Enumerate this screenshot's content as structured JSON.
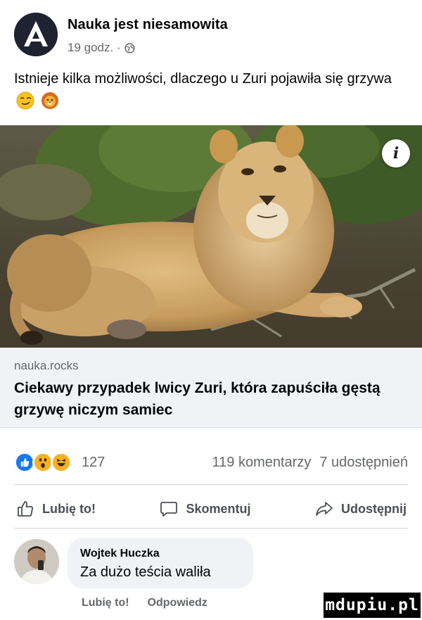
{
  "post": {
    "page_name": "Nauka jest niesamowita",
    "time": "19 godz. ·",
    "text": "Istnieje kilka możliwości, dlaczego u Zuri pojawiła się grzywa"
  },
  "link": {
    "domain": "nauka.rocks",
    "title": "Ciekawy przypadek lwicy Zuri, która zapuściła gęstą grzywę niczym samiec"
  },
  "reactions": {
    "count": "127",
    "comments": "119 komentarzy",
    "shares": "7 udostępnień"
  },
  "actions": {
    "like": "Lubię to!",
    "comment": "Skomentuj",
    "share": "Udostępnij"
  },
  "comment": {
    "author": "Wojtek Huczka",
    "text": "Za dużo teścia waliła",
    "like": "Lubię to!",
    "reply": "Odpowiedz"
  },
  "watermark": "mdupiu.pl",
  "icons": [
    "page-avatar-icon",
    "globe-icon",
    "smirk-emoji-icon",
    "lion-emoji-icon",
    "info-icon",
    "like-reaction-icon",
    "wow-reaction-icon",
    "haha-reaction-icon",
    "thumbs-up-icon",
    "comment-icon",
    "share-icon"
  ],
  "colors": {
    "like_blue": "#1877f2",
    "reaction_yellow": "#f7b125",
    "meta_gray": "#65676b",
    "card_bg": "#f0f2f5"
  }
}
